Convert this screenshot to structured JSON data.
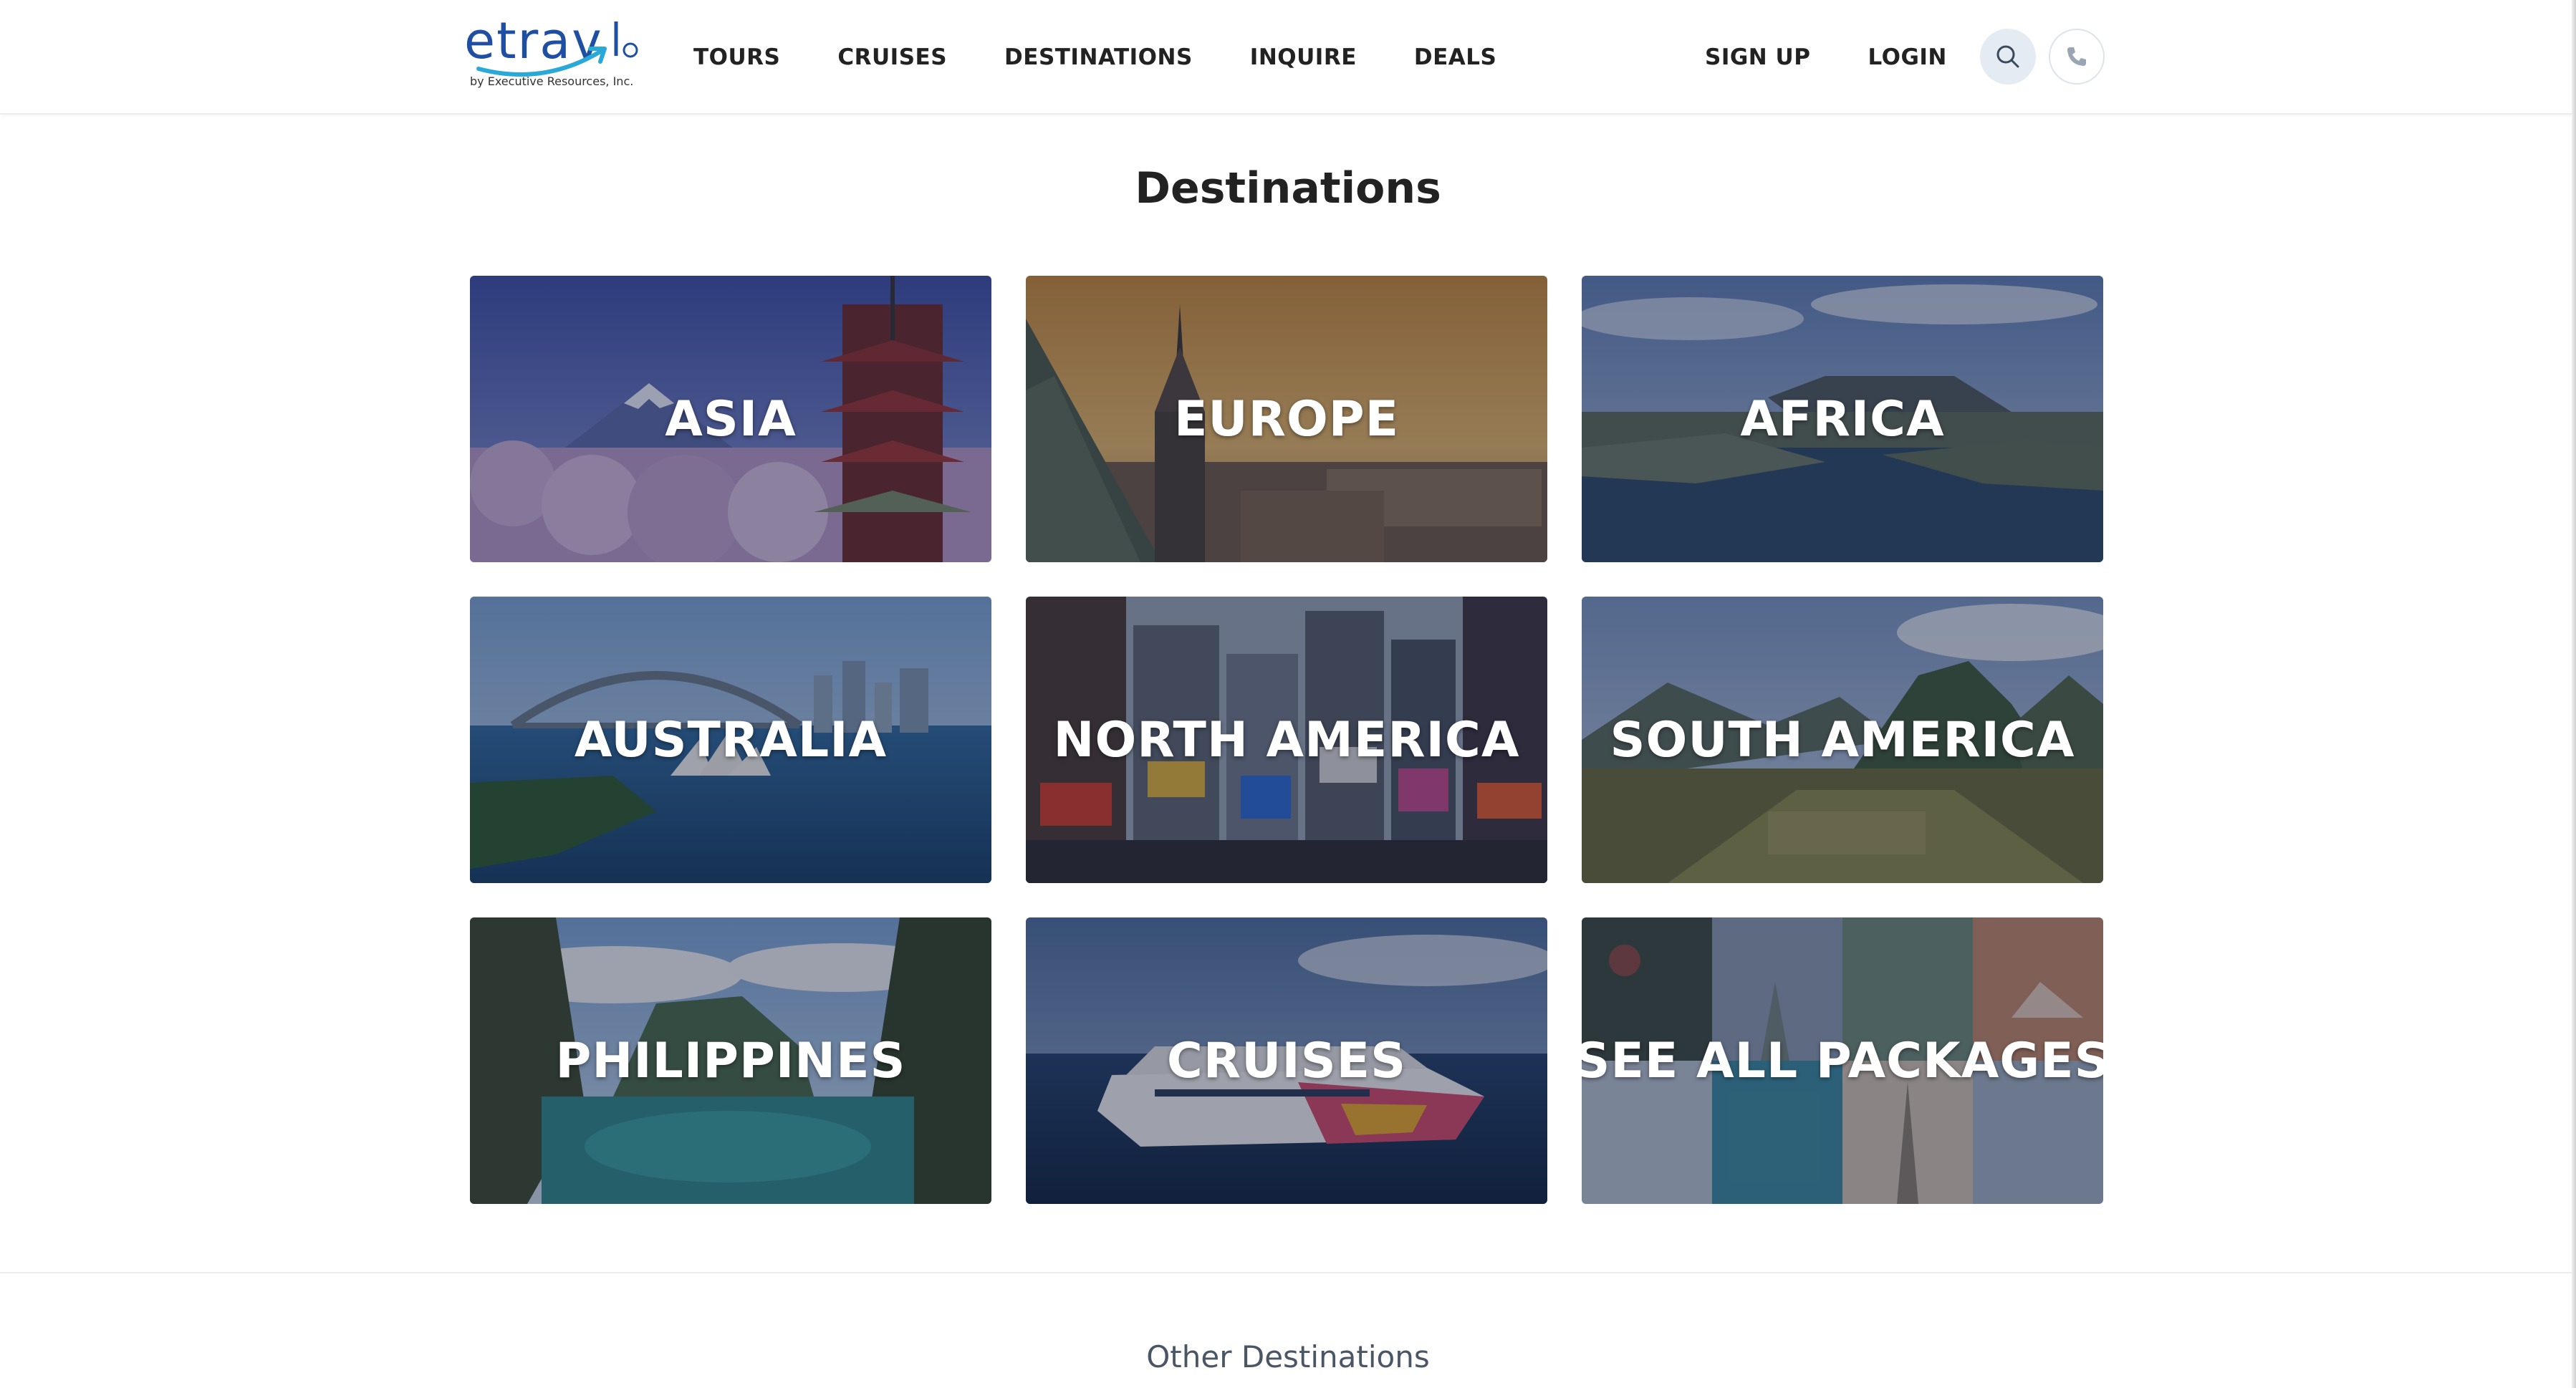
{
  "header": {
    "logo_main": "etrav",
    "logo_sub": "by Executive Resources, Inc.",
    "nav": [
      "TOURS",
      "CRUISES",
      "DESTINATIONS",
      "INQUIRE",
      "DEALS"
    ],
    "auth": [
      "SIGN UP",
      "LOGIN"
    ],
    "icons": {
      "search": "search-icon",
      "phone": "phone-icon"
    }
  },
  "main": {
    "title": "Destinations",
    "cards": [
      {
        "label": "ASIA"
      },
      {
        "label": "EUROPE"
      },
      {
        "label": "AFRICA"
      },
      {
        "label": "AUSTRALIA"
      },
      {
        "label": "NORTH AMERICA"
      },
      {
        "label": "SOUTH AMERICA"
      },
      {
        "label": "PHILIPPINES"
      },
      {
        "label": "CRUISES"
      },
      {
        "label": "SEE ALL PACKAGES"
      }
    ]
  },
  "other": {
    "title": "Other Destinations"
  },
  "colors": {
    "brand": "#1f4fa3",
    "accent": "#2aa8d8",
    "text": "#222222"
  }
}
